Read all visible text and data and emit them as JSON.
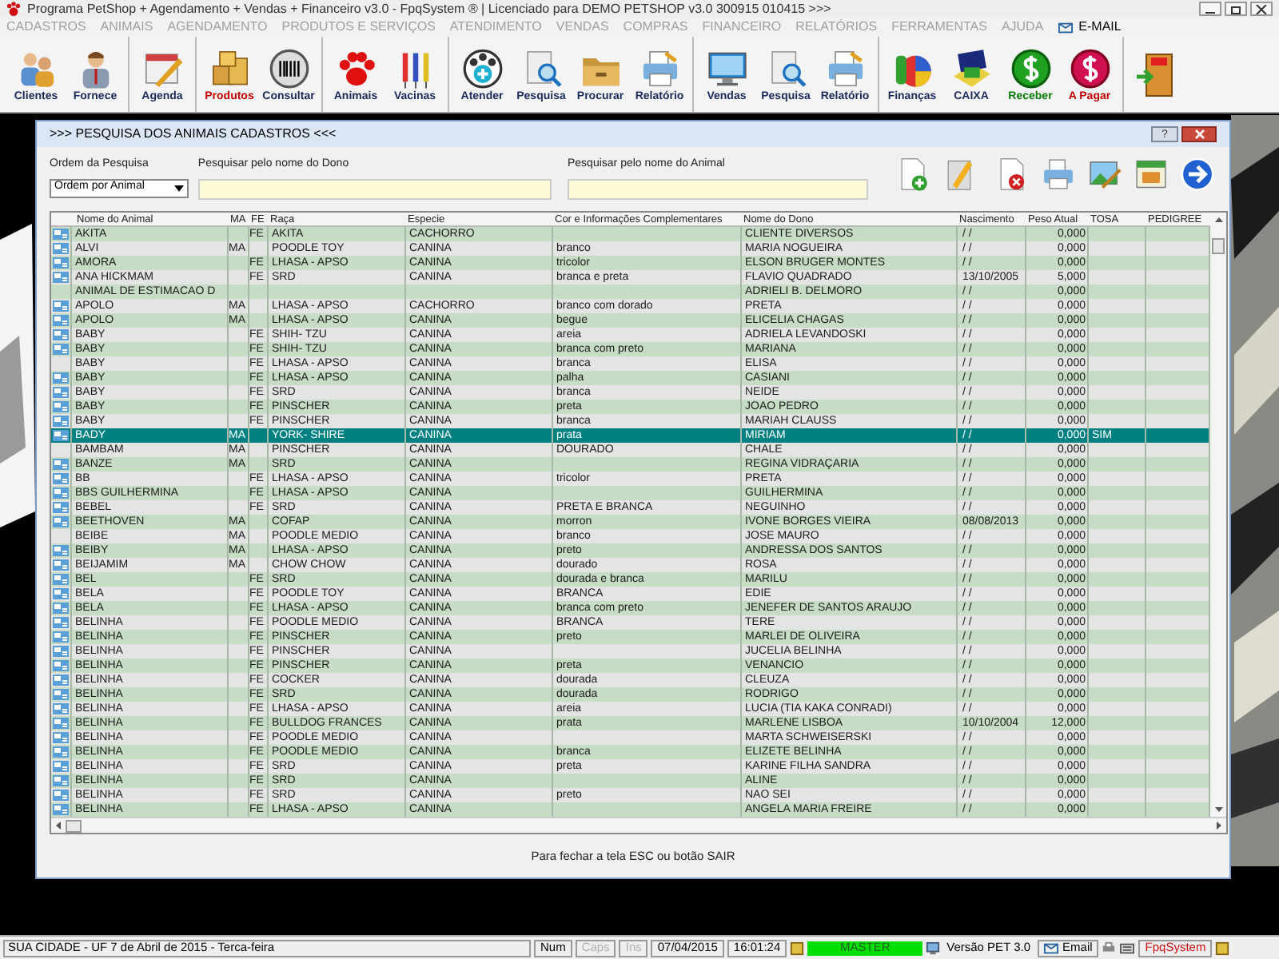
{
  "window": {
    "title": "Programa PetShop + Agendamento + Vendas + Financeiro v3.0 - FpqSystem ® | Licenciado para  DEMO PETSHOP v3.0 300915 010415 >>>"
  },
  "menu": [
    {
      "label": "CADASTROS",
      "disabled": true
    },
    {
      "label": "ANIMAIS",
      "disabled": true
    },
    {
      "label": "AGENDAMENTO",
      "disabled": true
    },
    {
      "label": "PRODUTOS E SERVIÇOS",
      "disabled": true
    },
    {
      "label": "ATENDIMENTO",
      "disabled": true
    },
    {
      "label": "VENDAS",
      "disabled": true
    },
    {
      "label": "COMPRAS",
      "disabled": true
    },
    {
      "label": "FINANCEIRO",
      "disabled": true
    },
    {
      "label": "RELATÓRIOS",
      "disabled": true
    },
    {
      "label": "FERRAMENTAS",
      "disabled": true
    },
    {
      "label": "AJUDA",
      "disabled": true
    },
    {
      "label": "E-MAIL",
      "disabled": false
    }
  ],
  "toolbar": [
    [
      {
        "label": "Clientes",
        "color": "#1a2a5a"
      },
      {
        "label": "Fornece",
        "color": "#1a2a5a"
      }
    ],
    [
      {
        "label": "Agenda",
        "color": "#1a2a5a"
      }
    ],
    [
      {
        "label": "Produtos",
        "color": "#c00000"
      },
      {
        "label": "Consultar",
        "color": "#1a2a5a"
      }
    ],
    [
      {
        "label": "Animais",
        "color": "#1a2a5a"
      },
      {
        "label": "Vacinas",
        "color": "#1a2a5a"
      }
    ],
    [
      {
        "label": "Atender",
        "color": "#1a2a5a"
      },
      {
        "label": "Pesquisa",
        "color": "#1a2a5a"
      },
      {
        "label": "Procurar",
        "color": "#1a2a5a"
      },
      {
        "label": "Relatório",
        "color": "#1a2a5a"
      }
    ],
    [
      {
        "label": "Vendas",
        "color": "#1a2a5a"
      },
      {
        "label": "Pesquisa",
        "color": "#1a2a5a"
      },
      {
        "label": "Relatório",
        "color": "#1a2a5a"
      }
    ],
    [
      {
        "label": "Finanças",
        "color": "#1a2a5a"
      },
      {
        "label": "CAIXA",
        "color": "#1a2a5a"
      },
      {
        "label": "Receber",
        "color": "#0a7a0a"
      },
      {
        "label": "A Pagar",
        "color": "#c00000"
      }
    ]
  ],
  "dialog": {
    "title": ">>> PESQUISA DOS ANIMAIS CADASTROS <<<",
    "help_button": "?",
    "order": {
      "label": "Ordem da Pesquisa",
      "value": "Ordem por Animal"
    },
    "owner_search": {
      "label": "Pesquisar pelo nome do Dono"
    },
    "animal_search": {
      "label": "Pesquisar pelo nome do Animal"
    },
    "footer": "Para fechar a tela ESC ou botão SAIR"
  },
  "table": {
    "columns": [
      "Nome do Animal",
      "MA",
      "FE",
      "Raça",
      "Especie",
      "Cor e Informações Complementares",
      "Nome do Dono",
      "Nascimento",
      "Peso Atual",
      "TOSA",
      "PEDIGREE"
    ],
    "rows": [
      {
        "icon": true,
        "selected": false,
        "name": "AKITA",
        "fe": "FE",
        "breed": "AKITA",
        "species": "CACHORRO",
        "owner": "CLIENTE DIVERSOS",
        "birth": "/ /",
        "weight": "0,000"
      },
      {
        "icon": true,
        "selected": false,
        "name": "ALVI",
        "ma": "MA",
        "breed": "POODLE TOY",
        "species": "CANINA",
        "info": "branco",
        "owner": "MARIA NOGUEIRA",
        "birth": "/ /",
        "weight": "0,000"
      },
      {
        "icon": true,
        "selected": false,
        "name": "AMORA",
        "fe": "FE",
        "breed": "LHASA - APSO",
        "species": "CANINA",
        "info": "tricolor",
        "owner": "ELSON BRUGER MONTES",
        "birth": "/ /",
        "weight": "0,000"
      },
      {
        "icon": true,
        "selected": false,
        "name": "ANA HICKMAM",
        "fe": "FE",
        "breed": "SRD",
        "species": "CANINA",
        "info": "branca e preta",
        "owner": "FLAVIO QUADRADO",
        "birth": "13/10/2005",
        "weight": "5,000"
      },
      {
        "icon": false,
        "selected": false,
        "name": "ANIMAL DE ESTIMACAO D",
        "owner": "ADRIELI B. DELMORO",
        "birth": "/ /",
        "weight": "0,000"
      },
      {
        "icon": true,
        "selected": false,
        "name": "APOLO",
        "ma": "MA",
        "breed": "LHASA - APSO",
        "species": "CACHORRO",
        "info": "branco com dorado",
        "owner": "PRETA",
        "birth": "/ /",
        "weight": "0,000"
      },
      {
        "icon": true,
        "selected": false,
        "name": "APOLO",
        "ma": "MA",
        "breed": "LHASA - APSO",
        "species": "CANINA",
        "info": "begue",
        "owner": "ELICELIA CHAGAS",
        "birth": "/ /",
        "weight": "0,000"
      },
      {
        "icon": true,
        "selected": false,
        "name": "BABY",
        "fe": "FE",
        "breed": "SHIH- TZU",
        "species": "CANINA",
        "info": "areia",
        "owner": "ADRIELA LEVANDOSKI",
        "birth": "/ /",
        "weight": "0,000"
      },
      {
        "icon": true,
        "selected": false,
        "name": "BABY",
        "fe": "FE",
        "breed": "SHIH- TZU",
        "species": "CANINA",
        "info": "branca com preto",
        "owner": "MARIANA",
        "birth": "/ /",
        "weight": "0,000"
      },
      {
        "icon": false,
        "selected": false,
        "name": "BABY",
        "fe": "FE",
        "breed": "LHASA - APSO",
        "species": "CANINA",
        "info": "branca",
        "owner": "ELISA",
        "birth": "/ /",
        "weight": "0,000"
      },
      {
        "icon": true,
        "selected": false,
        "name": "BABY",
        "fe": "FE",
        "breed": "LHASA - APSO",
        "species": "CANINA",
        "info": "palha",
        "owner": "CASIANI",
        "birth": "/ /",
        "weight": "0,000"
      },
      {
        "icon": true,
        "selected": false,
        "name": "BABY",
        "fe": "FE",
        "breed": "SRD",
        "species": "CANINA",
        "info": "branca",
        "owner": "NEIDE",
        "birth": "/ /",
        "weight": "0,000"
      },
      {
        "icon": true,
        "selected": false,
        "name": "BABY",
        "fe": "FE",
        "breed": "PINSCHER",
        "species": "CANINA",
        "info": "preta",
        "owner": "JOAO PEDRO",
        "birth": "/ /",
        "weight": "0,000"
      },
      {
        "icon": true,
        "selected": false,
        "name": "BABY",
        "fe": "FE",
        "breed": "PINSCHER",
        "species": "CANINA",
        "info": "branca",
        "owner": "MARIAH CLAUSS",
        "birth": "/ /",
        "weight": "0,000"
      },
      {
        "icon": true,
        "selected": true,
        "name": "BADY",
        "ma": "MA",
        "breed": "YORK- SHIRE",
        "species": "CANINA",
        "info": "prata",
        "owner": "MIRIAM",
        "birth": "/ /",
        "weight": "0,000",
        "tosa": "SIM"
      },
      {
        "icon": false,
        "selected": false,
        "name": "BAMBAM",
        "ma": "MA",
        "breed": "PINSCHER",
        "species": "CANINA",
        "info": "DOURADO",
        "owner": "CHALE",
        "birth": "/ /",
        "weight": "0,000"
      },
      {
        "icon": true,
        "selected": false,
        "name": "BANZE",
        "ma": "MA",
        "breed": "SRD",
        "species": "CANINA",
        "owner": "REGINA VIDRAÇARIA",
        "birth": "/ /",
        "weight": "0,000"
      },
      {
        "icon": true,
        "selected": false,
        "name": "BB",
        "fe": "FE",
        "breed": "LHASA - APSO",
        "species": "CANINA",
        "info": "tricolor",
        "owner": "PRETA",
        "birth": "/ /",
        "weight": "0,000"
      },
      {
        "icon": true,
        "selected": false,
        "name": "BBS GUILHERMINA",
        "fe": "FE",
        "breed": "LHASA - APSO",
        "species": "CANINA",
        "owner": "GUILHERMINA",
        "birth": "/ /",
        "weight": "0,000"
      },
      {
        "icon": true,
        "selected": false,
        "name": "BEBEL",
        "fe": "FE",
        "breed": "SRD",
        "species": "CANINA",
        "info": "PRETA E BRANCA",
        "owner": "NEGUINHO",
        "birth": "/ /",
        "weight": "0,000"
      },
      {
        "icon": true,
        "selected": false,
        "name": "BEETHOVEN",
        "ma": "MA",
        "breed": "COFAP",
        "species": "CANINA",
        "info": "morron",
        "owner": "IVONE BORGES VIEIRA",
        "birth": "08/08/2013",
        "weight": "0,000"
      },
      {
        "icon": false,
        "selected": false,
        "name": "BEIBE",
        "ma": "MA",
        "breed": "POODLE MEDIO",
        "species": "CANINA",
        "info": "branco",
        "owner": "JOSE MAURO",
        "birth": "/ /",
        "weight": "0,000"
      },
      {
        "icon": true,
        "selected": false,
        "name": "BEIBY",
        "ma": "MA",
        "breed": "LHASA - APSO",
        "species": "CANINA",
        "info": "preto",
        "owner": "ANDRESSA DOS SANTOS",
        "birth": "/ /",
        "weight": "0,000"
      },
      {
        "icon": true,
        "selected": false,
        "name": "BEIJAMIM",
        "ma": "MA",
        "breed": "CHOW CHOW",
        "species": "CANINA",
        "info": "dourado",
        "owner": "ROSA",
        "birth": "/ /",
        "weight": "0,000"
      },
      {
        "icon": true,
        "selected": false,
        "name": "BEL",
        "fe": "FE",
        "breed": "SRD",
        "species": "CANINA",
        "info": "dourada e branca",
        "owner": "MARILU",
        "birth": "/ /",
        "weight": "0,000"
      },
      {
        "icon": true,
        "selected": false,
        "name": "BELA",
        "fe": "FE",
        "breed": "POODLE TOY",
        "species": "CANINA",
        "info": "BRANCA",
        "owner": "EDIE",
        "birth": "/ /",
        "weight": "0,000"
      },
      {
        "icon": true,
        "selected": false,
        "name": "BELA",
        "fe": "FE",
        "breed": "LHASA - APSO",
        "species": "CANINA",
        "info": "branca com preto",
        "owner": "JENEFER DE SANTOS ARAUJO",
        "birth": "/ /",
        "weight": "0,000"
      },
      {
        "icon": true,
        "selected": false,
        "name": "BELINHA",
        "fe": "FE",
        "breed": "POODLE MEDIO",
        "species": "CANINA",
        "info": "BRANCA",
        "owner": "TERE",
        "birth": "/ /",
        "weight": "0,000"
      },
      {
        "icon": true,
        "selected": false,
        "name": "BELINHA",
        "fe": "FE",
        "breed": "PINSCHER",
        "species": "CANINA",
        "info": "preto",
        "owner": "MARLEI DE OLIVEIRA",
        "birth": "/ /",
        "weight": "0,000"
      },
      {
        "icon": true,
        "selected": false,
        "name": "BELINHA",
        "fe": "FE",
        "breed": "PINSCHER",
        "species": "CANINA",
        "owner": "JUCELIA BELINHA",
        "birth": "/ /",
        "weight": "0,000"
      },
      {
        "icon": true,
        "selected": false,
        "name": "BELINHA",
        "fe": "FE",
        "breed": "PINSCHER",
        "species": "CANINA",
        "info": "preta",
        "owner": "VENANCIO",
        "birth": "/ /",
        "weight": "0,000"
      },
      {
        "icon": true,
        "selected": false,
        "name": "BELINHA",
        "fe": "FE",
        "breed": "COCKER",
        "species": "CANINA",
        "info": "dourada",
        "owner": "CLEUZA",
        "birth": "/ /",
        "weight": "0,000"
      },
      {
        "icon": true,
        "selected": false,
        "name": "BELINHA",
        "fe": "FE",
        "breed": "SRD",
        "species": "CANINA",
        "info": "dourada",
        "owner": "RODRIGO",
        "birth": "/ /",
        "weight": "0,000"
      },
      {
        "icon": true,
        "selected": false,
        "name": "BELINHA",
        "fe": "FE",
        "breed": "LHASA - APSO",
        "species": "CANINA",
        "info": "areia",
        "owner": "LUCIA (TIA KAKA CONRADI)",
        "birth": "/ /",
        "weight": "0,000"
      },
      {
        "icon": true,
        "selected": false,
        "name": "BELINHA",
        "fe": "FE",
        "breed": "BULLDOG FRANCES",
        "species": "CANINA",
        "info": "prata",
        "owner": "MARLENE LISBOA",
        "birth": "10/10/2004",
        "weight": "12,000"
      },
      {
        "icon": true,
        "selected": false,
        "name": "BELINHA",
        "fe": "FE",
        "breed": "POODLE MEDIO",
        "species": "CANINA",
        "owner": "MARTA SCHWEISERSKI",
        "birth": "/ /",
        "weight": "0,000"
      },
      {
        "icon": true,
        "selected": false,
        "name": "BELINHA",
        "fe": "FE",
        "breed": "POODLE MEDIO",
        "species": "CANINA",
        "info": "branca",
        "owner": "ELIZETE  BELINHA",
        "birth": "/ /",
        "weight": "0,000"
      },
      {
        "icon": true,
        "selected": false,
        "name": "BELINHA",
        "fe": "FE",
        "breed": "SRD",
        "species": "CANINA",
        "info": "preta",
        "owner": "KARINE FILHA SANDRA",
        "birth": "/ /",
        "weight": "0,000"
      },
      {
        "icon": true,
        "selected": false,
        "name": "BELINHA",
        "fe": "FE",
        "breed": "SRD",
        "species": "CANINA",
        "owner": "ALINE",
        "birth": "/ /",
        "weight": "0,000"
      },
      {
        "icon": true,
        "selected": false,
        "name": "BELINHA",
        "fe": "FE",
        "breed": "SRD",
        "species": "CANINA",
        "info": "preto",
        "owner": "NAO SEI",
        "birth": "/ /",
        "weight": "0,000"
      },
      {
        "icon": true,
        "selected": false,
        "name": "BELINHA",
        "fe": "FE",
        "breed": "LHASA - APSO",
        "species": "CANINA",
        "owner": "ANGELA MARIA FREIRE",
        "birth": "/ /",
        "weight": "0,000"
      }
    ]
  },
  "status_bar": {
    "location_date": "SUA CIDADE - UF  7 de Abril de 2015 - Terca-feira",
    "keys": [
      {
        "label": "Num",
        "on": true
      },
      {
        "label": "Caps",
        "on": false
      },
      {
        "label": "Ins",
        "on": false
      }
    ],
    "date": "07/04/2015",
    "time": "16:01:24",
    "user": "MASTER",
    "version": "Versão PET 3.0",
    "email": "Email",
    "brand": "FpqSystem"
  }
}
